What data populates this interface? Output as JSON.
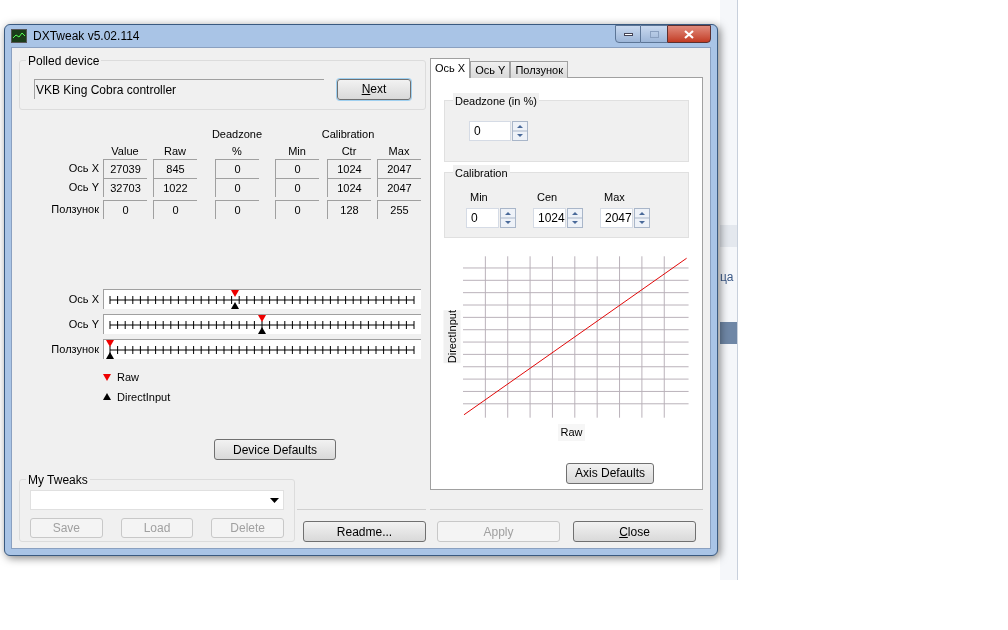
{
  "window": {
    "title": "DXTweak v5.02.114"
  },
  "polled_device": {
    "label": "Polled device",
    "value": "VKB King Cobra controller",
    "button": {
      "label": "Next",
      "mnemonic_underlined": true
    }
  },
  "table": {
    "group_headers": [
      "Deadzone",
      "Calibration"
    ],
    "columns": [
      "Value",
      "Raw",
      "%",
      "Min",
      "Ctr",
      "Max"
    ],
    "rows": [
      {
        "label": "Ось X",
        "cells": [
          "27039",
          "845",
          "0",
          "0",
          "1024",
          "2047"
        ]
      },
      {
        "label": "Ось Y",
        "cells": [
          "32703",
          "1022",
          "0",
          "0",
          "1024",
          "2047"
        ]
      },
      {
        "label": "Ползунок",
        "cells": [
          "0",
          "0",
          "0",
          "0",
          "128",
          "255"
        ]
      }
    ]
  },
  "axes": [
    {
      "label": "Ось X",
      "raw": {
        "level": 0.41
      },
      "directinput": {
        "level": 0.41
      }
    },
    {
      "label": "Ось Y",
      "raw": {
        "level": 0.5
      },
      "directinput": {
        "level": 0.5
      }
    },
    {
      "label": "Ползунок",
      "raw": {
        "level": 0
      },
      "directinput": {
        "level": 0
      }
    }
  ],
  "legend": [
    {
      "kind": "raw",
      "label": "Raw"
    },
    {
      "kind": "directinput",
      "label": "DirectInput"
    }
  ],
  "device_defaults_button": {
    "label": "Device Defaults"
  },
  "my_tweaks": {
    "label": "My Tweaks",
    "buttons": [
      {
        "label": "Save",
        "disabled": true
      },
      {
        "label": "Load",
        "disabled": true
      },
      {
        "label": "Delete",
        "disabled": true
      }
    ]
  },
  "tabs": [
    {
      "label": "Ось X",
      "selected": true
    },
    {
      "label": "Ось Y",
      "selected": false
    },
    {
      "label": "Ползунок",
      "selected": false
    }
  ],
  "deadzone": {
    "label": "Deadzone (in %)",
    "value": "0"
  },
  "calibration": {
    "label": "Calibration",
    "fields": [
      {
        "label": "Min",
        "value": "0"
      },
      {
        "label": "Cen",
        "value": "1024"
      },
      {
        "label": "Max",
        "value": "2047"
      }
    ]
  },
  "curve": {
    "ylabel": "DirectInput",
    "xlabel": "Raw"
  },
  "axis_defaults_button": {
    "label": "Axis Defaults"
  },
  "bottom_buttons": [
    {
      "label": "Readme...",
      "disabled": false,
      "mnemonic_underlined": false
    },
    {
      "label": "Apply",
      "disabled": true,
      "mnemonic_underlined": false
    },
    {
      "label": "Close",
      "disabled": false,
      "mnemonic_underlined": true
    }
  ],
  "background": {
    "fragment": "ца"
  }
}
